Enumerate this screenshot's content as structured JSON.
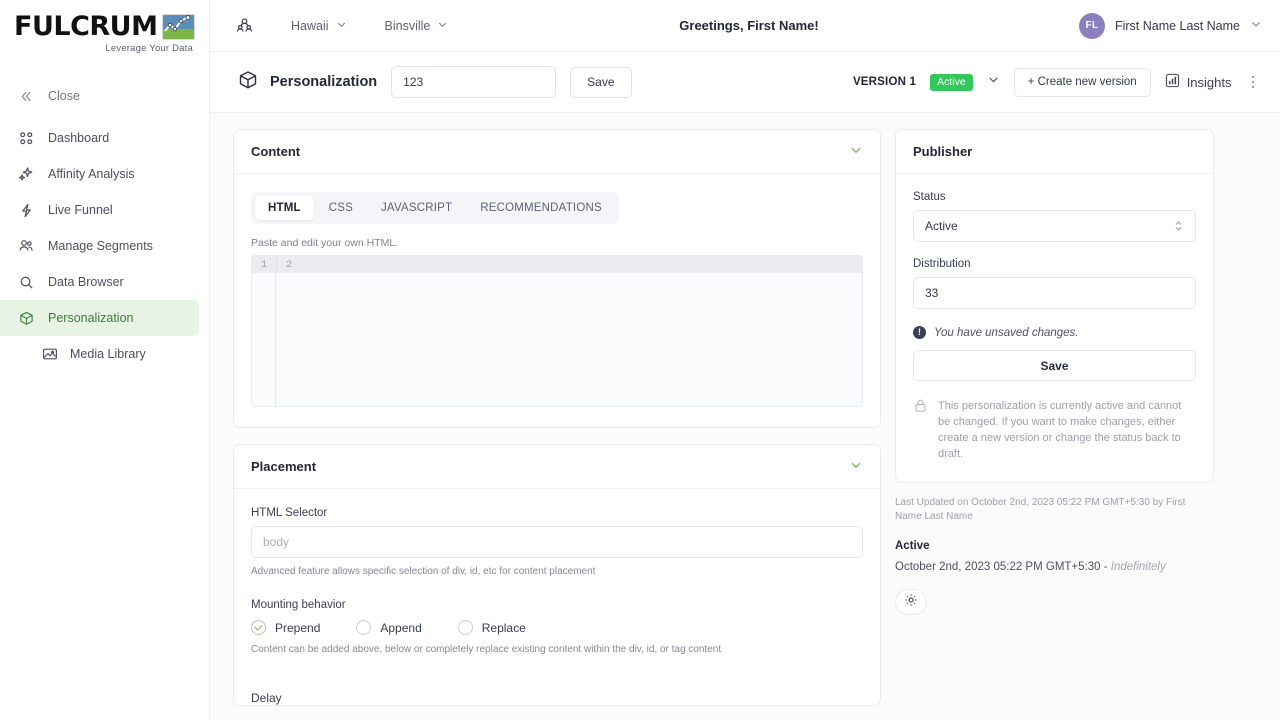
{
  "sidebar": {
    "logo": {
      "word": "FULCRUM",
      "tagline": "Leverage Your Data"
    },
    "items": [
      {
        "label": "Close",
        "icon": "double-chevron-left-icon"
      },
      {
        "label": "Dashboard",
        "icon": "grid-icon"
      },
      {
        "label": "Affinity Analysis",
        "icon": "sparkles-icon"
      },
      {
        "label": "Live Funnel",
        "icon": "bolt-icon"
      },
      {
        "label": "Manage Segments",
        "icon": "people-icon"
      },
      {
        "label": "Data Browser",
        "icon": "search-icon"
      },
      {
        "label": "Personalization",
        "icon": "cube-icon"
      },
      {
        "label": "Media Library",
        "icon": "image-icon"
      }
    ]
  },
  "topbar": {
    "group_icon": "people-group-icon",
    "breadcrumbs": [
      {
        "label": "Hawaii"
      },
      {
        "label": "Binsville"
      }
    ],
    "greeting": "Greetings, First Name!",
    "user": {
      "initials": "FL",
      "name": "First Name Last Name",
      "avatar_color": "#8b7fbd"
    }
  },
  "toolbar": {
    "icon": "cube-icon",
    "title": "Personalization",
    "name_value": "123",
    "save_label": "Save",
    "version_label": "VERSION 1",
    "version_badge": "Active",
    "badge_color": "#34c759",
    "create_version_label": "+ Create new version",
    "insights_label": "Insights",
    "insights_icon": "bar-chart-icon",
    "kebab_icon": "more-vertical-icon"
  },
  "content": {
    "title": "Content",
    "collapse_icon": "chevron-down-icon",
    "tabs": [
      {
        "label": "HTML",
        "active": true
      },
      {
        "label": "CSS",
        "active": false
      },
      {
        "label": "JAVASCRIPT",
        "active": false
      },
      {
        "label": "RECOMMENDATIONS",
        "active": false
      }
    ],
    "hint": "Paste and edit your own HTML.",
    "editor": {
      "gutter_line": "1",
      "code_line": "2",
      "value": ""
    }
  },
  "placement": {
    "title": "Placement",
    "collapse_icon": "chevron-down-icon",
    "selector_label": "HTML Selector",
    "selector_value": "",
    "selector_placeholder": "body",
    "selector_help": "Advanced feature allows specific selection of div, id, etc for content placement",
    "mounting_label": "Mounting behavior",
    "mounting_options": [
      {
        "label": "Prepend",
        "selected": true
      },
      {
        "label": "Append",
        "selected": false
      },
      {
        "label": "Replace",
        "selected": false
      }
    ],
    "mounting_help": "Content can be added above, below or completely replace existing content within the div, id, or tag content",
    "delay_label": "Delay"
  },
  "publisher": {
    "title": "Publisher",
    "status_label": "Status",
    "status_value": "Active",
    "distribution_label": "Distribution",
    "distribution_value": "33",
    "unsaved_text": "You have unsaved changes.",
    "unsaved_icon": "exclamation-circle-icon",
    "save_label": "Save",
    "lock_icon": "lock-icon",
    "lock_text": "This personalization is currently active and cannot be changed. If you want to make changes, either create a new version or change the status back to draft.",
    "last_updated": "Last Updated on October 2nd, 2023 05:22 PM GMT+5:30 by First Name Last Name",
    "status_heading": "Active",
    "active_range": "October 2nd, 2023 05:22 PM GMT+5:30 - ",
    "active_range_suffix": "Indefinitely",
    "settings_icon": "gear-icon"
  }
}
